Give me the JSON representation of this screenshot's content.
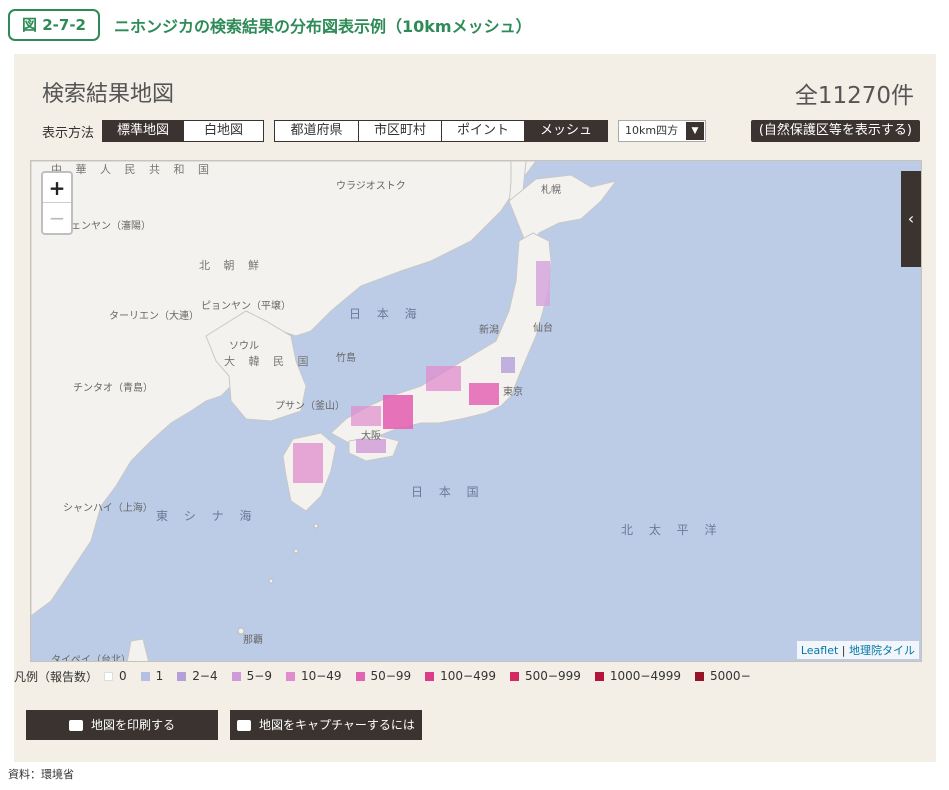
{
  "figure": {
    "number": "図 2-7-2",
    "title": "ニホンジカの検索結果の分布図表示例（10kmメッシュ）"
  },
  "page": {
    "title": "検索結果地図",
    "count": "全11270件"
  },
  "display_method": {
    "label": "表示方法",
    "map_types": [
      {
        "label": "標準地図",
        "active": true
      },
      {
        "label": "白地図",
        "active": false
      }
    ],
    "units": [
      {
        "label": "都道府県",
        "active": false
      },
      {
        "label": "市区町村",
        "active": false
      },
      {
        "label": "ポイント",
        "active": false
      },
      {
        "label": "メッシュ",
        "active": true
      }
    ],
    "mesh_size": "10km四方",
    "protected_areas_button": "(自然保護区等を表示する)"
  },
  "map": {
    "zoom_in": "+",
    "zoom_out": "−",
    "panel_toggle": "‹",
    "attribution_leaflet": "Leaflet",
    "attribution_tiles": "地理院タイル",
    "labels": {
      "china": "中 華 人 民 共 和 国",
      "vladivostok": "ウラジオストク",
      "shenyang": "シェンヤン（瀋陽）",
      "north_korea": "北 朝 鮮",
      "pyongyang": "ピョンヤン（平壌）",
      "dalian": "ターリエン（大連）",
      "seoul": "ソウル",
      "south_korea": "大 韓 民 国",
      "qingdao": "チンタオ（青島）",
      "busan": "プサン（釜山）",
      "sea_of_japan": "日 本 海",
      "east_china_sea": "東 シ ナ 海",
      "shanghai": "シャンハイ（上海）",
      "pacific": "北 太 平 洋",
      "japan": "日 本 国",
      "sapporo": "札幌",
      "niigata": "新潟",
      "sendai": "仙台",
      "tokyo": "東京",
      "osaka": "大阪",
      "takeshima": "竹島",
      "taipei": "タイペイ（台北）",
      "naha": "那覇"
    }
  },
  "legend": {
    "title": "凡例（報告数）",
    "items": [
      {
        "label": "0",
        "color": "#ffffff"
      },
      {
        "label": "1",
        "color": "#b4bfe3"
      },
      {
        "label": "2−4",
        "color": "#b49fd8"
      },
      {
        "label": "5−9",
        "color": "#cf9ad8"
      },
      {
        "label": "10−49",
        "color": "#e08ccd"
      },
      {
        "label": "50−99",
        "color": "#e464b4"
      },
      {
        "label": "100−499",
        "color": "#dc3c8c"
      },
      {
        "label": "500−999",
        "color": "#d22864"
      },
      {
        "label": "1000−4999",
        "color": "#b4143c"
      },
      {
        "label": "5000−",
        "color": "#961428"
      }
    ]
  },
  "actions": {
    "print": "地図を印刷する",
    "capture": "地図をキャプチャーするには"
  },
  "source": "資料：環境省"
}
